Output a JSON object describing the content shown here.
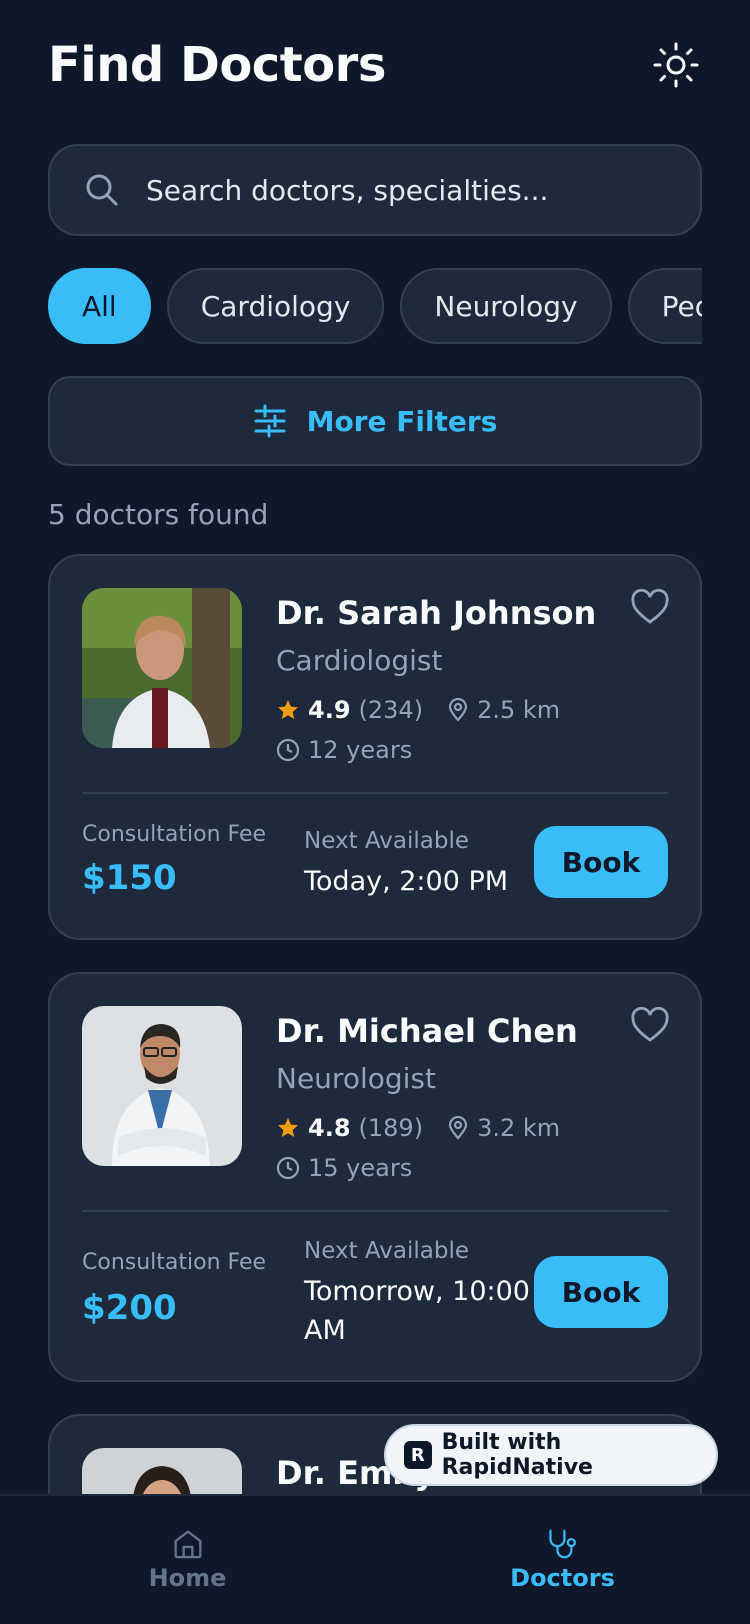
{
  "header": {
    "title": "Find Doctors",
    "theme_icon": "sun-icon"
  },
  "search": {
    "placeholder": "Search doctors, specialties..."
  },
  "chips": [
    "All",
    "Cardiology",
    "Neurology",
    "Pediatrics"
  ],
  "filters": {
    "label": "More Filters"
  },
  "results_count": "5 doctors found",
  "doctors": [
    {
      "name": "Dr. Sarah Johnson",
      "specialty": "Cardiologist",
      "rating": "4.9",
      "reviews": "(234)",
      "distance": "2.5 km",
      "experience": "12 years",
      "fee_label": "Consultation Fee",
      "fee": "$150",
      "next_label": "Next Available",
      "next": "Today, 2:00 PM",
      "book_label": "Book"
    },
    {
      "name": "Dr. Michael Chen",
      "specialty": "Neurologist",
      "rating": "4.8",
      "reviews": "(189)",
      "distance": "3.2 km",
      "experience": "15 years",
      "fee_label": "Consultation Fee",
      "fee": "$200",
      "next_label": "Next Available",
      "next": "Tomorrow, 10:00 AM",
      "book_label": "Book"
    },
    {
      "name": "Dr. Emily"
    }
  ],
  "badge": {
    "label": "Built with RapidNative"
  },
  "tabbar": {
    "home": "Home",
    "doctors": "Doctors"
  },
  "colors": {
    "accent": "#38bdf8",
    "background": "#0f172a",
    "card": "#1e293b",
    "star": "#f59e0b"
  }
}
